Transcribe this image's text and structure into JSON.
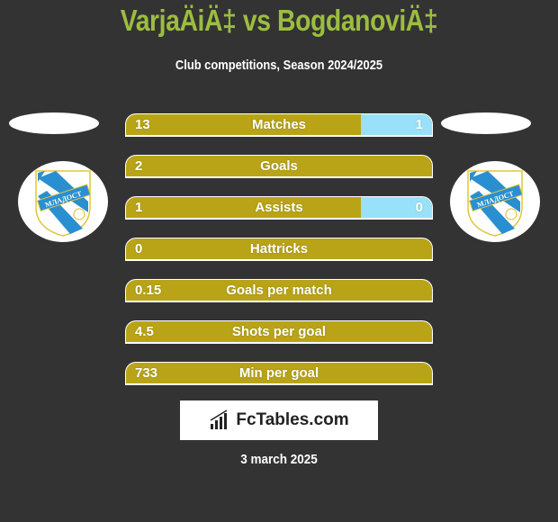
{
  "header": {
    "title": "VarjaÄiÄ‡ vs BogdanoviÄ‡",
    "subtitle": "Club competitions, Season 2024/2025"
  },
  "players": {
    "left": {
      "badge_text": "МЛАДОСТ"
    },
    "right": {
      "badge_text": "МЛАДОСТ"
    }
  },
  "colors": {
    "left_bar": "#b9a418",
    "right_bar": "#97e2f8",
    "title": "#9cbd3f",
    "background": "#333333"
  },
  "stats": [
    {
      "label": "Matches",
      "left": "13",
      "right": "1",
      "right_share": 0.232
    },
    {
      "label": "Goals",
      "left": "2",
      "right": "",
      "right_share": 0
    },
    {
      "label": "Assists",
      "left": "1",
      "right": "0",
      "right_share": 0.232
    },
    {
      "label": "Hattricks",
      "left": "0",
      "right": "",
      "right_share": 0
    },
    {
      "label": "Goals per match",
      "left": "0.15",
      "right": "",
      "right_share": 0
    },
    {
      "label": "Shots per goal",
      "left": "4.5",
      "right": "",
      "right_share": 0
    },
    {
      "label": "Min per goal",
      "left": "733",
      "right": "",
      "right_share": 0
    }
  ],
  "footer": {
    "brand": "FcTables.com",
    "date": "3 march 2025"
  }
}
